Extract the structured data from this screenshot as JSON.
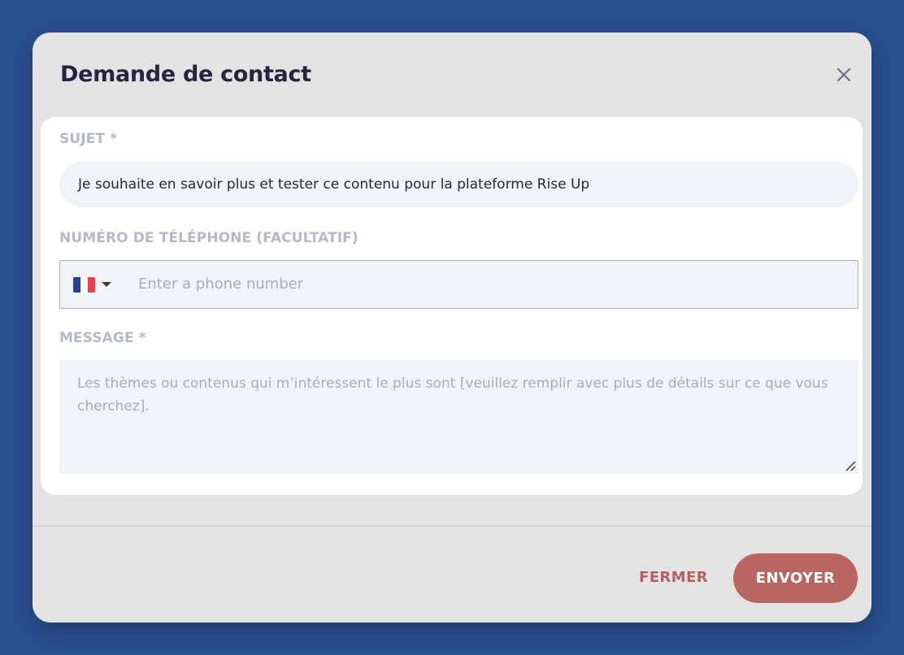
{
  "modal": {
    "title": "Demande de contact"
  },
  "form": {
    "subject": {
      "label": "SUJET *",
      "value": "Je souhaite en savoir plus et tester ce contenu pour la plateforme Rise Up"
    },
    "phone": {
      "label": "NUMÉRO DE TÉLÉPHONE (FACULTATIF)",
      "placeholder": "Enter a phone number",
      "country_flag": "france-flag-icon"
    },
    "message": {
      "label": "MESSAGE *",
      "placeholder": "Les thèmes ou contenus qui m’intéressent le plus sont [veuillez remplir avec plus de détails sur ce que vous cherchez]."
    }
  },
  "footer": {
    "close_label": "FERMER",
    "send_label": "ENVOYER"
  },
  "colors": {
    "backdrop": "#2a5090",
    "modal_bg": "#e3e3e4",
    "accent": "#b96561",
    "label": "#b3b9c5",
    "title": "#25253f"
  }
}
